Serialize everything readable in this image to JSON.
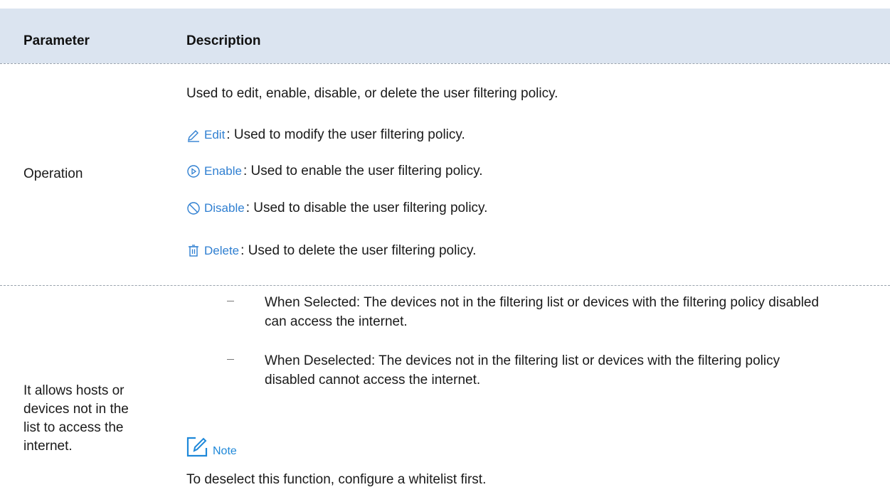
{
  "table": {
    "headers": {
      "parameter": "Parameter",
      "description": "Description"
    },
    "rows": [
      {
        "parameter": "Operation",
        "intro": "Used to edit, enable, disable, or delete the user filtering policy.",
        "operations": [
          {
            "icon": "edit-pencil-icon",
            "label": "Edit",
            "text": ": Used to modify the user filtering policy."
          },
          {
            "icon": "enable-play-icon",
            "label": "Enable",
            "text": ": Used to enable the user filtering policy."
          },
          {
            "icon": "disable-circle-slash-icon",
            "label": "Disable",
            "text": " : Used to disable the user filtering policy."
          },
          {
            "icon": "delete-trash-icon",
            "label": "Delete",
            "text": " : Used to delete the user filtering policy."
          }
        ]
      },
      {
        "parameter_lines": [
          "It allows hosts or",
          "devices not in the",
          "list to access the",
          "internet."
        ],
        "bullets": [
          "When Selected: The devices not in the filtering list or devices with the filtering policy disabled can access the internet.",
          "When Deselected: The devices not in the filtering list or devices with the filtering policy disabled cannot access the internet."
        ],
        "note_label": "Note",
        "note_text": "To deselect this function, configure a whitelist first."
      }
    ]
  },
  "colors": {
    "header_bg": "#dbe4f0",
    "icon_blue": "#2f7fd1",
    "note_blue": "#1e88d9"
  }
}
